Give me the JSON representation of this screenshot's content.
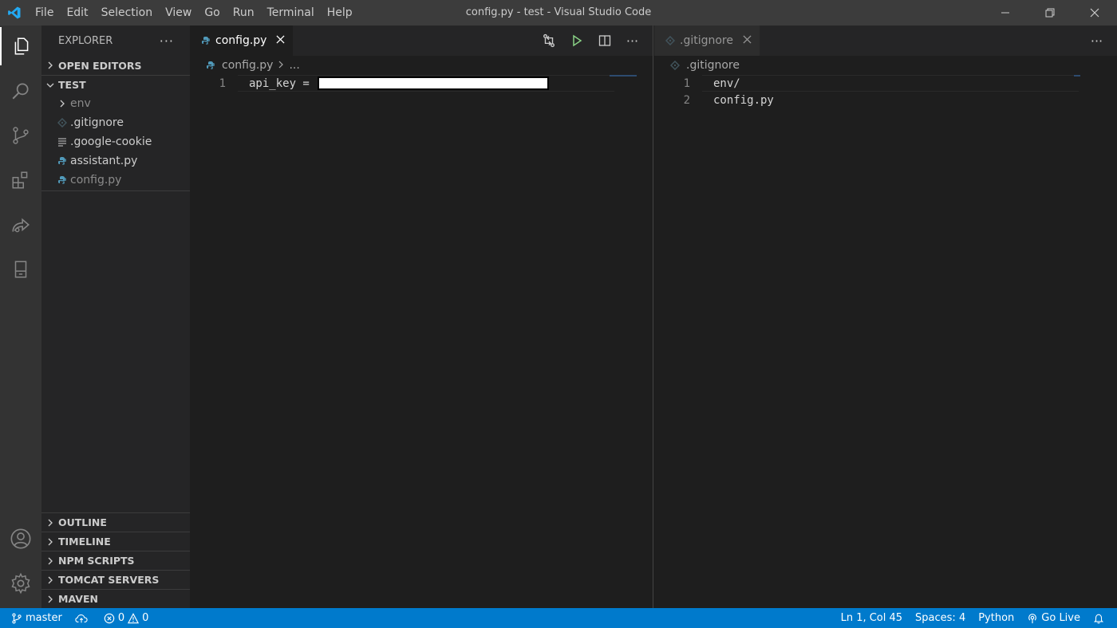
{
  "window": {
    "title": "config.py - test - Visual Studio Code",
    "menu": [
      "File",
      "Edit",
      "Selection",
      "View",
      "Go",
      "Run",
      "Terminal",
      "Help"
    ]
  },
  "activity_bar": [
    "explorer-icon",
    "search-icon",
    "source-control-icon",
    "extensions-icon",
    "live-share-icon",
    "remote-explorer-icon",
    "accounts-icon",
    "settings-gear-icon"
  ],
  "sidebar": {
    "title": "EXPLORER",
    "more": "···",
    "open_editors": "OPEN EDITORS",
    "workspace": "TEST",
    "files": [
      {
        "label": "env",
        "kind": "folder"
      },
      {
        "label": ".gitignore",
        "kind": "git"
      },
      {
        "label": ".google-cookie",
        "kind": "text"
      },
      {
        "label": "assistant.py",
        "kind": "python"
      },
      {
        "label": "config.py",
        "kind": "python"
      }
    ],
    "bottom_sections": [
      "OUTLINE",
      "TIMELINE",
      "NPM SCRIPTS",
      "TOMCAT SERVERS",
      "MAVEN"
    ]
  },
  "left_editor": {
    "tab_label": "config.py",
    "breadcrumb_file": "config.py",
    "breadcrumb_more": "...",
    "more": "···",
    "lines": [
      {
        "num": "1",
        "text": "api_key = "
      }
    ]
  },
  "right_editor": {
    "tab_label": ".gitignore",
    "breadcrumb_file": ".gitignore",
    "more": "···",
    "lines": [
      {
        "num": "1",
        "text": "env/"
      },
      {
        "num": "2",
        "text": "config.py"
      }
    ]
  },
  "status": {
    "branch": "master",
    "errors": "0",
    "warnings": "0",
    "position": "Ln 1, Col 45",
    "spaces": "Spaces: 4",
    "language": "Python",
    "golive": "Go Live"
  },
  "colors": {
    "accent": "#007acc",
    "python": "#519aba",
    "run": "#89d185"
  }
}
